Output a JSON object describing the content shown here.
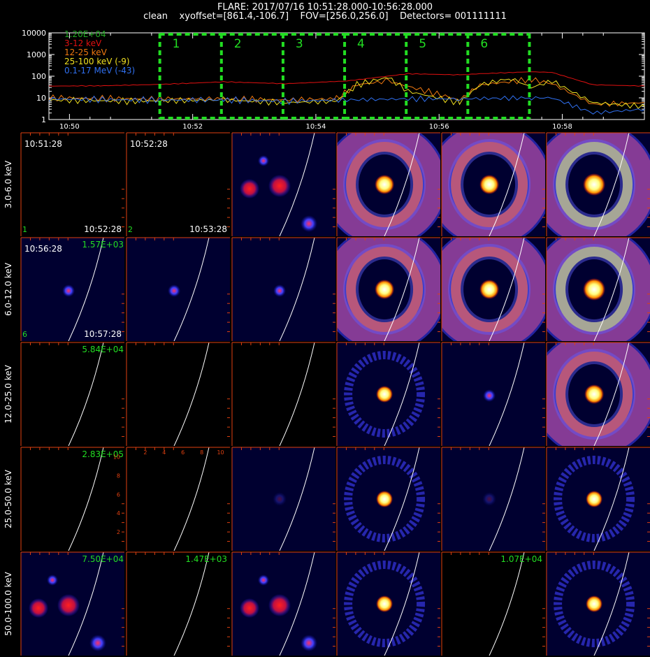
{
  "header": {
    "line1": "FLARE: 2017/07/16 10:51:28.000-10:56:28.000",
    "line2": "clean    xyoffset=[861.4,-106.7]    FOV=[256.0,256.0]    Detectors= 001111111"
  },
  "chart_data": [
    {
      "type": "line",
      "yscale": "log",
      "ylim": [
        1,
        10000
      ],
      "xlim": [
        "10:49:40",
        "10:59:20"
      ],
      "y_ticks": [
        "1",
        "10",
        "100",
        "1000",
        "10000"
      ],
      "x_ticks": [
        "10:50",
        "10:52",
        "10:54",
        "10:56",
        "10:58"
      ],
      "peak_label": "1.20E+04",
      "series": [
        {
          "name": "3-12 keV",
          "color": "#e01010",
          "x": [
            "10:49:40",
            "10:50:30",
            "10:51:30",
            "10:52:30",
            "10:53:30",
            "10:54:30",
            "10:55:30",
            "10:56:20",
            "10:56:40",
            "10:57:30",
            "10:57:50",
            "10:58:30",
            "10:59:20"
          ],
          "y": [
            35,
            36,
            42,
            55,
            45,
            60,
            130,
            115,
            130,
            160,
            150,
            40,
            35
          ]
        },
        {
          "name": "12-25 keV",
          "color": "#f07810",
          "x": [
            "10:49:40",
            "10:51:00",
            "10:52:30",
            "10:53:30",
            "10:54:20",
            "10:54:40",
            "10:55:10",
            "10:56:20",
            "10:56:40",
            "10:57:30",
            "10:57:50",
            "10:58:30",
            "10:59:20"
          ],
          "y": [
            10,
            9,
            9,
            8,
            9,
            40,
            60,
            8,
            40,
            70,
            45,
            5,
            6
          ]
        },
        {
          "name": "25-100 keV (-9)",
          "color": "#f0e020",
          "x": [
            "10:49:40",
            "10:51:00",
            "10:52:30",
            "10:53:30",
            "10:54:20",
            "10:54:40",
            "10:55:10",
            "10:55:30",
            "10:56:20",
            "10:56:40",
            "10:57:10",
            "10:57:30",
            "10:57:50",
            "10:58:30",
            "10:59:20"
          ],
          "y": [
            8,
            7,
            8,
            6,
            7,
            40,
            90,
            20,
            6,
            40,
            80,
            30,
            60,
            6,
            4
          ]
        },
        {
          "name": "0.1-17 MeV (-43)",
          "color": "#3070f0",
          "x": [
            "10:49:40",
            "10:51:00",
            "10:52:30",
            "10:53:30",
            "10:54:30",
            "10:55:30",
            "10:56:20",
            "10:57:30",
            "10:57:50",
            "10:58:30",
            "10:59:20"
          ],
          "y": [
            9,
            8,
            8,
            7,
            8,
            9,
            9,
            10,
            10,
            2,
            3
          ]
        }
      ],
      "intervals": {
        "labels": [
          "1",
          "2",
          "3",
          "4",
          "5",
          "6"
        ],
        "boundaries": [
          "10:51:28",
          "10:52:28",
          "10:53:28",
          "10:54:28",
          "10:55:28",
          "10:56:28",
          "10:57:28"
        ],
        "color": "#22dd22"
      }
    },
    {
      "type": "heatmap",
      "energy_bands": [
        "3.0-6.0 keV",
        "6.0-12.0 keV",
        "12.0-25.0 keV",
        "25.0-50.0 keV",
        "50.0-100.0 keV"
      ],
      "time_intervals": [
        "1",
        "2",
        "3",
        "4",
        "5",
        "6"
      ],
      "intensity": [
        [
          0,
          0,
          0.35,
          0.85,
          0.85,
          1.0
        ],
        [
          0.2,
          0.2,
          0.2,
          0.85,
          0.85,
          1.0
        ],
        [
          0,
          0,
          0,
          0.5,
          0.25,
          0.9
        ],
        [
          0,
          0,
          0.05,
          0.5,
          0.05,
          0.5
        ],
        [
          0.3,
          0,
          0.35,
          0.55,
          0,
          0.55
        ]
      ],
      "row_peaks": [
        "",
        "1.57E+03",
        "5.84E+04",
        "2.83E+05",
        "7.50E+04"
      ],
      "extra_peaks": [
        {
          "row": 4,
          "col": 1,
          "text": "1.47E+03"
        },
        {
          "row": 4,
          "col": 4,
          "text": "1.07E+04"
        }
      ],
      "time_labels": [
        {
          "row": 0,
          "col": 0,
          "start": "10:51:28",
          "end": "10:52:28",
          "index": "1"
        },
        {
          "row": 0,
          "col": 1,
          "start": "10:52:28",
          "end": "10:53:28",
          "index": "2"
        },
        {
          "row": 1,
          "col": 0,
          "start": "10:56:28",
          "end": "10:57:28",
          "index": "6"
        }
      ],
      "tick_labels": [
        "2",
        "4",
        "6",
        "8",
        "10"
      ],
      "axis_color": "#e04010",
      "limb_color": "#ffffff"
    }
  ]
}
